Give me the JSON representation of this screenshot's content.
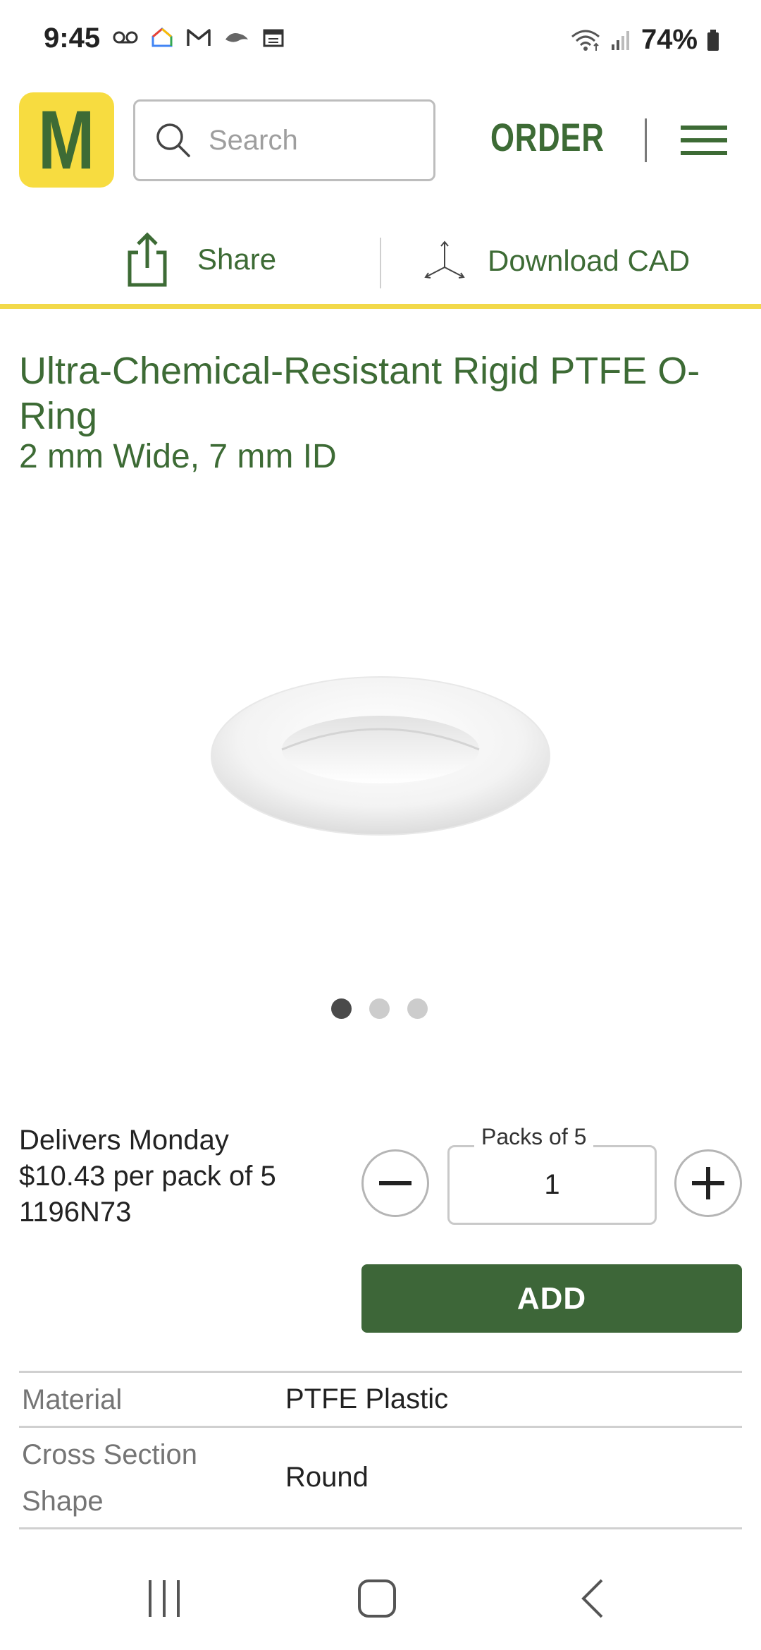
{
  "status_bar": {
    "time": "9:45",
    "battery": "74%",
    "left_icons": [
      "voicemail-icon",
      "google-home-icon",
      "gmail-icon",
      "ravens-icon",
      "calendar-icon"
    ],
    "right_icons": [
      "wifi-icon",
      "signal-icon",
      "battery-icon"
    ]
  },
  "header": {
    "logo_letter": "M",
    "search_placeholder": "Search",
    "order_label": "ORDER",
    "menu_icon": "hamburger-menu-icon"
  },
  "actions": {
    "share_label": "Share",
    "download_cad_label": "Download CAD"
  },
  "product": {
    "title": "Ultra-Chemical-Resistant Rigid PTFE O-Ring",
    "subtitle": "2 mm Wide, 7 mm ID",
    "image": "o-ring-image",
    "carousel": {
      "count": 3,
      "active": 1
    }
  },
  "purchase": {
    "delivery": "Delivers Monday",
    "price": "$10.43 per pack of 5",
    "part_number": "1196N73",
    "qty_label": "Packs of 5",
    "qty_value": "1",
    "add_label": "ADD"
  },
  "specs": [
    {
      "key": "Material",
      "value": "PTFE Plastic"
    },
    {
      "key": "Cross Section Shape",
      "value": "Round"
    }
  ],
  "colors": {
    "brand_green": "#3d6b35",
    "brand_yellow": "#f7dc40",
    "add_button": "#3d6638"
  }
}
